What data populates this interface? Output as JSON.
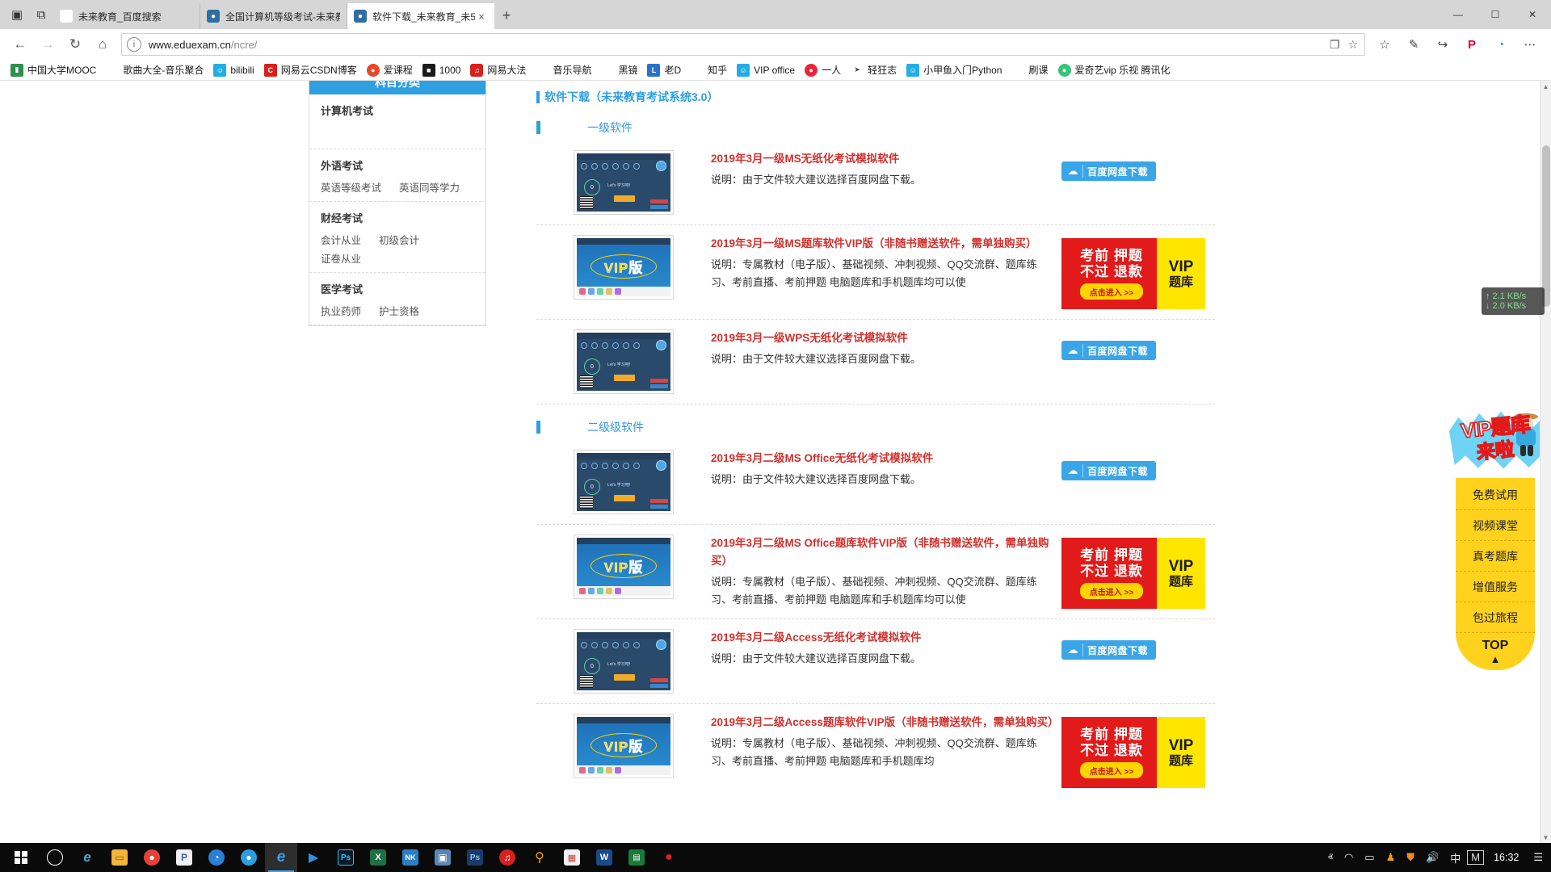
{
  "window": {
    "tabs": [
      {
        "title": "未来教育_百度搜索",
        "favicon": "baidu-icon",
        "active": false
      },
      {
        "title": "全国计算机等级考试-未来教",
        "favicon": "site-icon",
        "active": false
      },
      {
        "title": "软件下载_未来教育_未5",
        "favicon": "site-icon",
        "active": true
      }
    ],
    "newtab_label": "+",
    "tab_close_label": "×",
    "controls": {
      "minimize": "—",
      "maximize": "☐",
      "close": "✕"
    },
    "sys_icons": {
      "tab_preview": "❐",
      "split": "⧉"
    }
  },
  "navbar": {
    "back": "←",
    "forward": "→",
    "refresh": "↻",
    "home": "⌂",
    "url_strong": "www.eduexam.cn",
    "url_dim": "/ncre/",
    "info_icon": "ⓘ",
    "reading_view": "❐",
    "favorite_star": "☆",
    "toolbar_icons": [
      {
        "name": "favorites-icon",
        "glyph": "☆"
      },
      {
        "name": "web-notes-icon",
        "glyph": "✎"
      },
      {
        "name": "share-icon",
        "glyph": "↪"
      },
      {
        "name": "pinterest-icon",
        "glyph": "P"
      },
      {
        "name": "extension-icon",
        "glyph": "◔"
      },
      {
        "name": "settings-more-icon",
        "glyph": "⋯"
      }
    ]
  },
  "bookmarks": [
    {
      "label": "中国大学MOOC",
      "icon": "folder-green",
      "color": "#2f8f4e"
    },
    {
      "label": "歌曲大全-音乐聚合",
      "icon": "star",
      "color": ""
    },
    {
      "label": "bilibili",
      "icon": "bilibili",
      "color": "#23ade5"
    },
    {
      "label": "网易云CSDN博客",
      "icon": "csdn",
      "color": "#d8201c"
    },
    {
      "label": "爱课程",
      "icon": "aikecheng",
      "color": "#e8452b"
    },
    {
      "label": "1000",
      "icon": "camera",
      "color": "#1a1a1a"
    },
    {
      "label": "网易大法",
      "icon": "netease",
      "color": "#d8201c"
    },
    {
      "label": "音乐导航",
      "icon": "star",
      "color": ""
    },
    {
      "label": "黑镜",
      "icon": "star",
      "color": ""
    },
    {
      "label": "老D",
      "icon": "laod",
      "color": "#2a72c8"
    },
    {
      "label": "知乎",
      "icon": "star",
      "color": ""
    },
    {
      "label": "VIP office",
      "icon": "bilibili",
      "color": "#23ade5"
    },
    {
      "label": "一人",
      "icon": "yiren",
      "color": "#e8253a"
    },
    {
      "label": "轻狂志",
      "icon": "qingkuang",
      "color": "#444444"
    },
    {
      "label": "小甲鱼入门Python",
      "icon": "bilibili",
      "color": "#23ade5"
    },
    {
      "label": "刷课",
      "icon": "star",
      "color": ""
    },
    {
      "label": "爱奇艺vip 乐视 腾讯化",
      "icon": "iqiyi",
      "color": "#38c47a"
    }
  ],
  "sidebar": {
    "header": "科目分类",
    "groups": [
      {
        "title": "计算机考试",
        "links": []
      },
      {
        "title": "外语考试",
        "links": [
          "英语等级考试",
          "英语同等学力"
        ]
      },
      {
        "title": "财经考试",
        "links": [
          "会计从业",
          "初级会计",
          "证卷从业"
        ]
      },
      {
        "title": "医学考试",
        "links": [
          "执业药师",
          "护士资格"
        ]
      }
    ]
  },
  "main": {
    "page_title": "软件下载（未来教育考试系统3.0）",
    "sections": [
      {
        "heading": "一级软件",
        "items": [
          {
            "title": "2019年3月一级MS无纸化考试模拟软件",
            "desc": "说明：由于文件较大建议选择百度网盘下载。",
            "thumb": "exam-screenshot",
            "action": "download",
            "download_label": "百度网盘下载"
          },
          {
            "title": "2019年3月一级MS题库软件VIP版（非随书赠送软件，需单独购买）",
            "desc": "说明：专属教材（电子版）、基础视频、冲刺视频、QQ交流群、题库练习、考前直播、考前押题 电脑题库和手机题库均可以使",
            "thumb": "vip-banner",
            "action": "ad"
          },
          {
            "title": "2019年3月一级WPS无纸化考试模拟软件",
            "desc": "说明：由于文件较大建议选择百度网盘下载。",
            "thumb": "exam-screenshot",
            "action": "download",
            "download_label": "百度网盘下载"
          }
        ]
      },
      {
        "heading": "二级级软件",
        "items": [
          {
            "title": "2019年3月二级MS Office无纸化考试模拟软件",
            "desc": "说明：由于文件较大建议选择百度网盘下载。",
            "thumb": "exam-screenshot",
            "action": "download",
            "download_label": "百度网盘下载"
          },
          {
            "title": "2019年3月二级MS Office题库软件VIP版（非随书赠送软件，需单独购买）",
            "desc": "说明：专属教材（电子版）、基础视频、冲刺视频、QQ交流群、题库练习、考前直播、考前押题 电脑题库和手机题库均可以使",
            "thumb": "vip-banner",
            "action": "ad"
          },
          {
            "title": "2019年3月二级Access无纸化考试模拟软件",
            "desc": "说明：由于文件较大建议选择百度网盘下载。",
            "thumb": "exam-screenshot",
            "action": "download",
            "download_label": "百度网盘下载"
          },
          {
            "title": "2019年3月二级Access题库软件VIP版（非随书赠送软件，需单独购买）",
            "desc": "说明：专属教材（电子版）、基础视频、冲刺视频、QQ交流群、题库练习、考前直播、考前押题 电脑题库和手机题库均",
            "thumb": "vip-banner",
            "action": "ad"
          }
        ]
      }
    ],
    "ad_banner": {
      "line1": "考前 押题",
      "line2": "不过 退款",
      "button": "点击进入 >>",
      "side_line1": "VIP",
      "side_line2": "题库"
    },
    "thumb_labels": {
      "vip_word": "VIP版",
      "counter": "0",
      "greeting": "Let's 学习吧!",
      "button": "开始考试"
    }
  },
  "floater": {
    "title_line1": "VIP题库",
    "title_line2": "来啦",
    "items": [
      "免费试用",
      "视频课堂",
      "真考题库",
      "增值服务",
      "包过旅程"
    ],
    "top_label": "TOP",
    "top_arrow": "▲"
  },
  "netspeed": {
    "up": "↑ 2.1 KB/s",
    "down": "↓ 2.0 KB/s"
  },
  "taskbar": {
    "start": "start-button",
    "items": [
      {
        "name": "cortana-icon",
        "glyph": "○",
        "color": "#0a0a0a",
        "text": "#ffffff"
      },
      {
        "name": "internet-explorer-icon",
        "glyph": "e",
        "color": "#0a0a0a",
        "text": "#4aa5d8"
      },
      {
        "name": "file-explorer-icon",
        "glyph": "▭",
        "color": "#f2b53a",
        "text": "#8a5a00"
      },
      {
        "name": "chrome-icon",
        "glyph": "◉",
        "color": "#e84135",
        "text": "#ffffff"
      },
      {
        "name": "foxit-reader-icon",
        "glyph": "P",
        "color": "#f0f0f0",
        "text": "#3a5fa8"
      },
      {
        "name": "clock-app-icon",
        "glyph": "◔",
        "color": "#2a7fd4",
        "text": "#ffffff"
      },
      {
        "name": "chrome-beta-icon",
        "glyph": "●",
        "color": "#2a9fe0",
        "text": "#ffffff"
      },
      {
        "name": "edge-icon",
        "glyph": "e",
        "color": "#0a0a0a",
        "text": "#3aa0e8",
        "active": true
      },
      {
        "name": "media-player-icon",
        "glyph": "▶",
        "color": "#0a0a0a",
        "text": "#2f8fd8"
      },
      {
        "name": "photoshop-icon",
        "glyph": "Ps",
        "color": "#0a1a2a",
        "text": "#31c5f0"
      },
      {
        "name": "excel-icon",
        "glyph": "X",
        "color": "#1d7044",
        "text": "#ffffff"
      },
      {
        "name": "netkeeper-icon",
        "glyph": "NK",
        "color": "#2a7fc4",
        "text": "#ffffff"
      },
      {
        "name": "screenshot-tool-icon",
        "glyph": "▣",
        "color": "#5a86b8",
        "text": "#ffffff"
      },
      {
        "name": "photoshop-2-icon",
        "glyph": "Ps",
        "color": "#1a3a6a",
        "text": "#8ac8f0"
      },
      {
        "name": "netease-music-icon",
        "glyph": "♫",
        "color": "#d8201c",
        "text": "#ffffff"
      },
      {
        "name": "search-everything-icon",
        "glyph": "⚲",
        "color": "#0a0a0a",
        "text": "#f0a020"
      },
      {
        "name": "store-icon",
        "glyph": "☰",
        "color": "#f0f0f0",
        "text": "#c44040"
      },
      {
        "name": "wps-writer-icon",
        "glyph": "W",
        "color": "#1a4a8a",
        "text": "#ffffff"
      },
      {
        "name": "quran-app-icon",
        "glyph": "☰",
        "color": "#1a7a3a",
        "text": "#ffffff"
      },
      {
        "name": "record-icon",
        "glyph": "●",
        "color": "#0a0a0a",
        "text": "#e02020"
      }
    ],
    "tray": [
      {
        "name": "show-hidden-icons",
        "glyph": "ⱏ"
      },
      {
        "name": "wifi-icon",
        "glyph": "◠"
      },
      {
        "name": "battery-icon",
        "glyph": "▭"
      },
      {
        "name": "netkeeper-tray-icon",
        "glyph": "♟"
      },
      {
        "name": "security-shield-icon",
        "glyph": "⛊"
      },
      {
        "name": "volume-icon",
        "glyph": "🔊"
      },
      {
        "name": "ime-chinese-icon",
        "glyph": "中"
      },
      {
        "name": "ime-mode-icon",
        "glyph": "M"
      }
    ],
    "clock": "16:32",
    "action_center": "☰"
  }
}
